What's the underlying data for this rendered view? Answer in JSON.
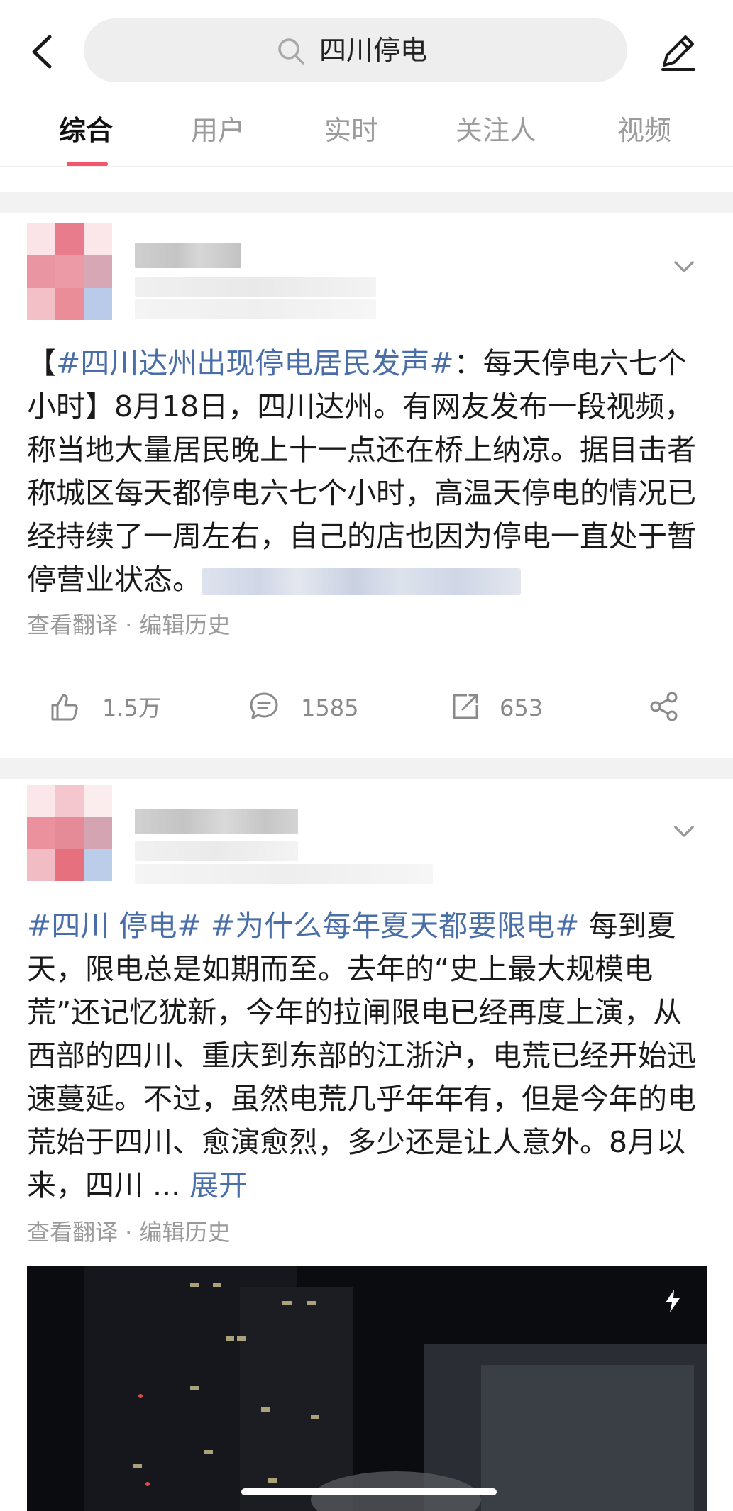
{
  "header": {
    "back_icon": "chevron-left-icon",
    "search_query": "四川停电",
    "search_icon": "search-icon",
    "edit_icon": "pencil-icon"
  },
  "tabs": [
    {
      "label": "综合",
      "active": true
    },
    {
      "label": "用户",
      "active": false
    },
    {
      "label": "实时",
      "active": false
    },
    {
      "label": "关注人",
      "active": false
    },
    {
      "label": "视频",
      "active": false
    }
  ],
  "accent_color": "#f2556c",
  "link_color": "#4a6fa8",
  "posts": [
    {
      "hashtag": "#四川达州出现停电居民发声#",
      "bracket_open": "【",
      "title_rest": "：每天停电六七个小时】",
      "body": "8月18日，四川达州。有网友发布一段视频，称当地大量居民晚上十一点还在桥上纳凉。据目击者称城区每天都停电六七个小时，高温天停电的情况已经持续了一周左右，自己的店也因为停电一直处于暂停营业状态。",
      "meta": "查看翻译 · 编辑历史",
      "likes": "1.5万",
      "comments": "1585",
      "shares": "653"
    },
    {
      "hashtag1": "#四川 停电#",
      "hashtag2": "#为什么每年夏天都要限电#",
      "body": " 每到夏天，限电总是如期而至。去年的“史上最大规模电荒”还记忆犹新，今年的拉闸限电已经再度上演，从西部的四川、重庆到东部的江浙沪，电荒已经开始迅速蔓延。不过，虽然电荒几乎年年有，但是今年的电荒始于四川、愈演愈烈，多少还是让人意外。8月以来，四川 ... ",
      "expand": "展开",
      "meta": "查看翻译 · 编辑历史"
    }
  ]
}
